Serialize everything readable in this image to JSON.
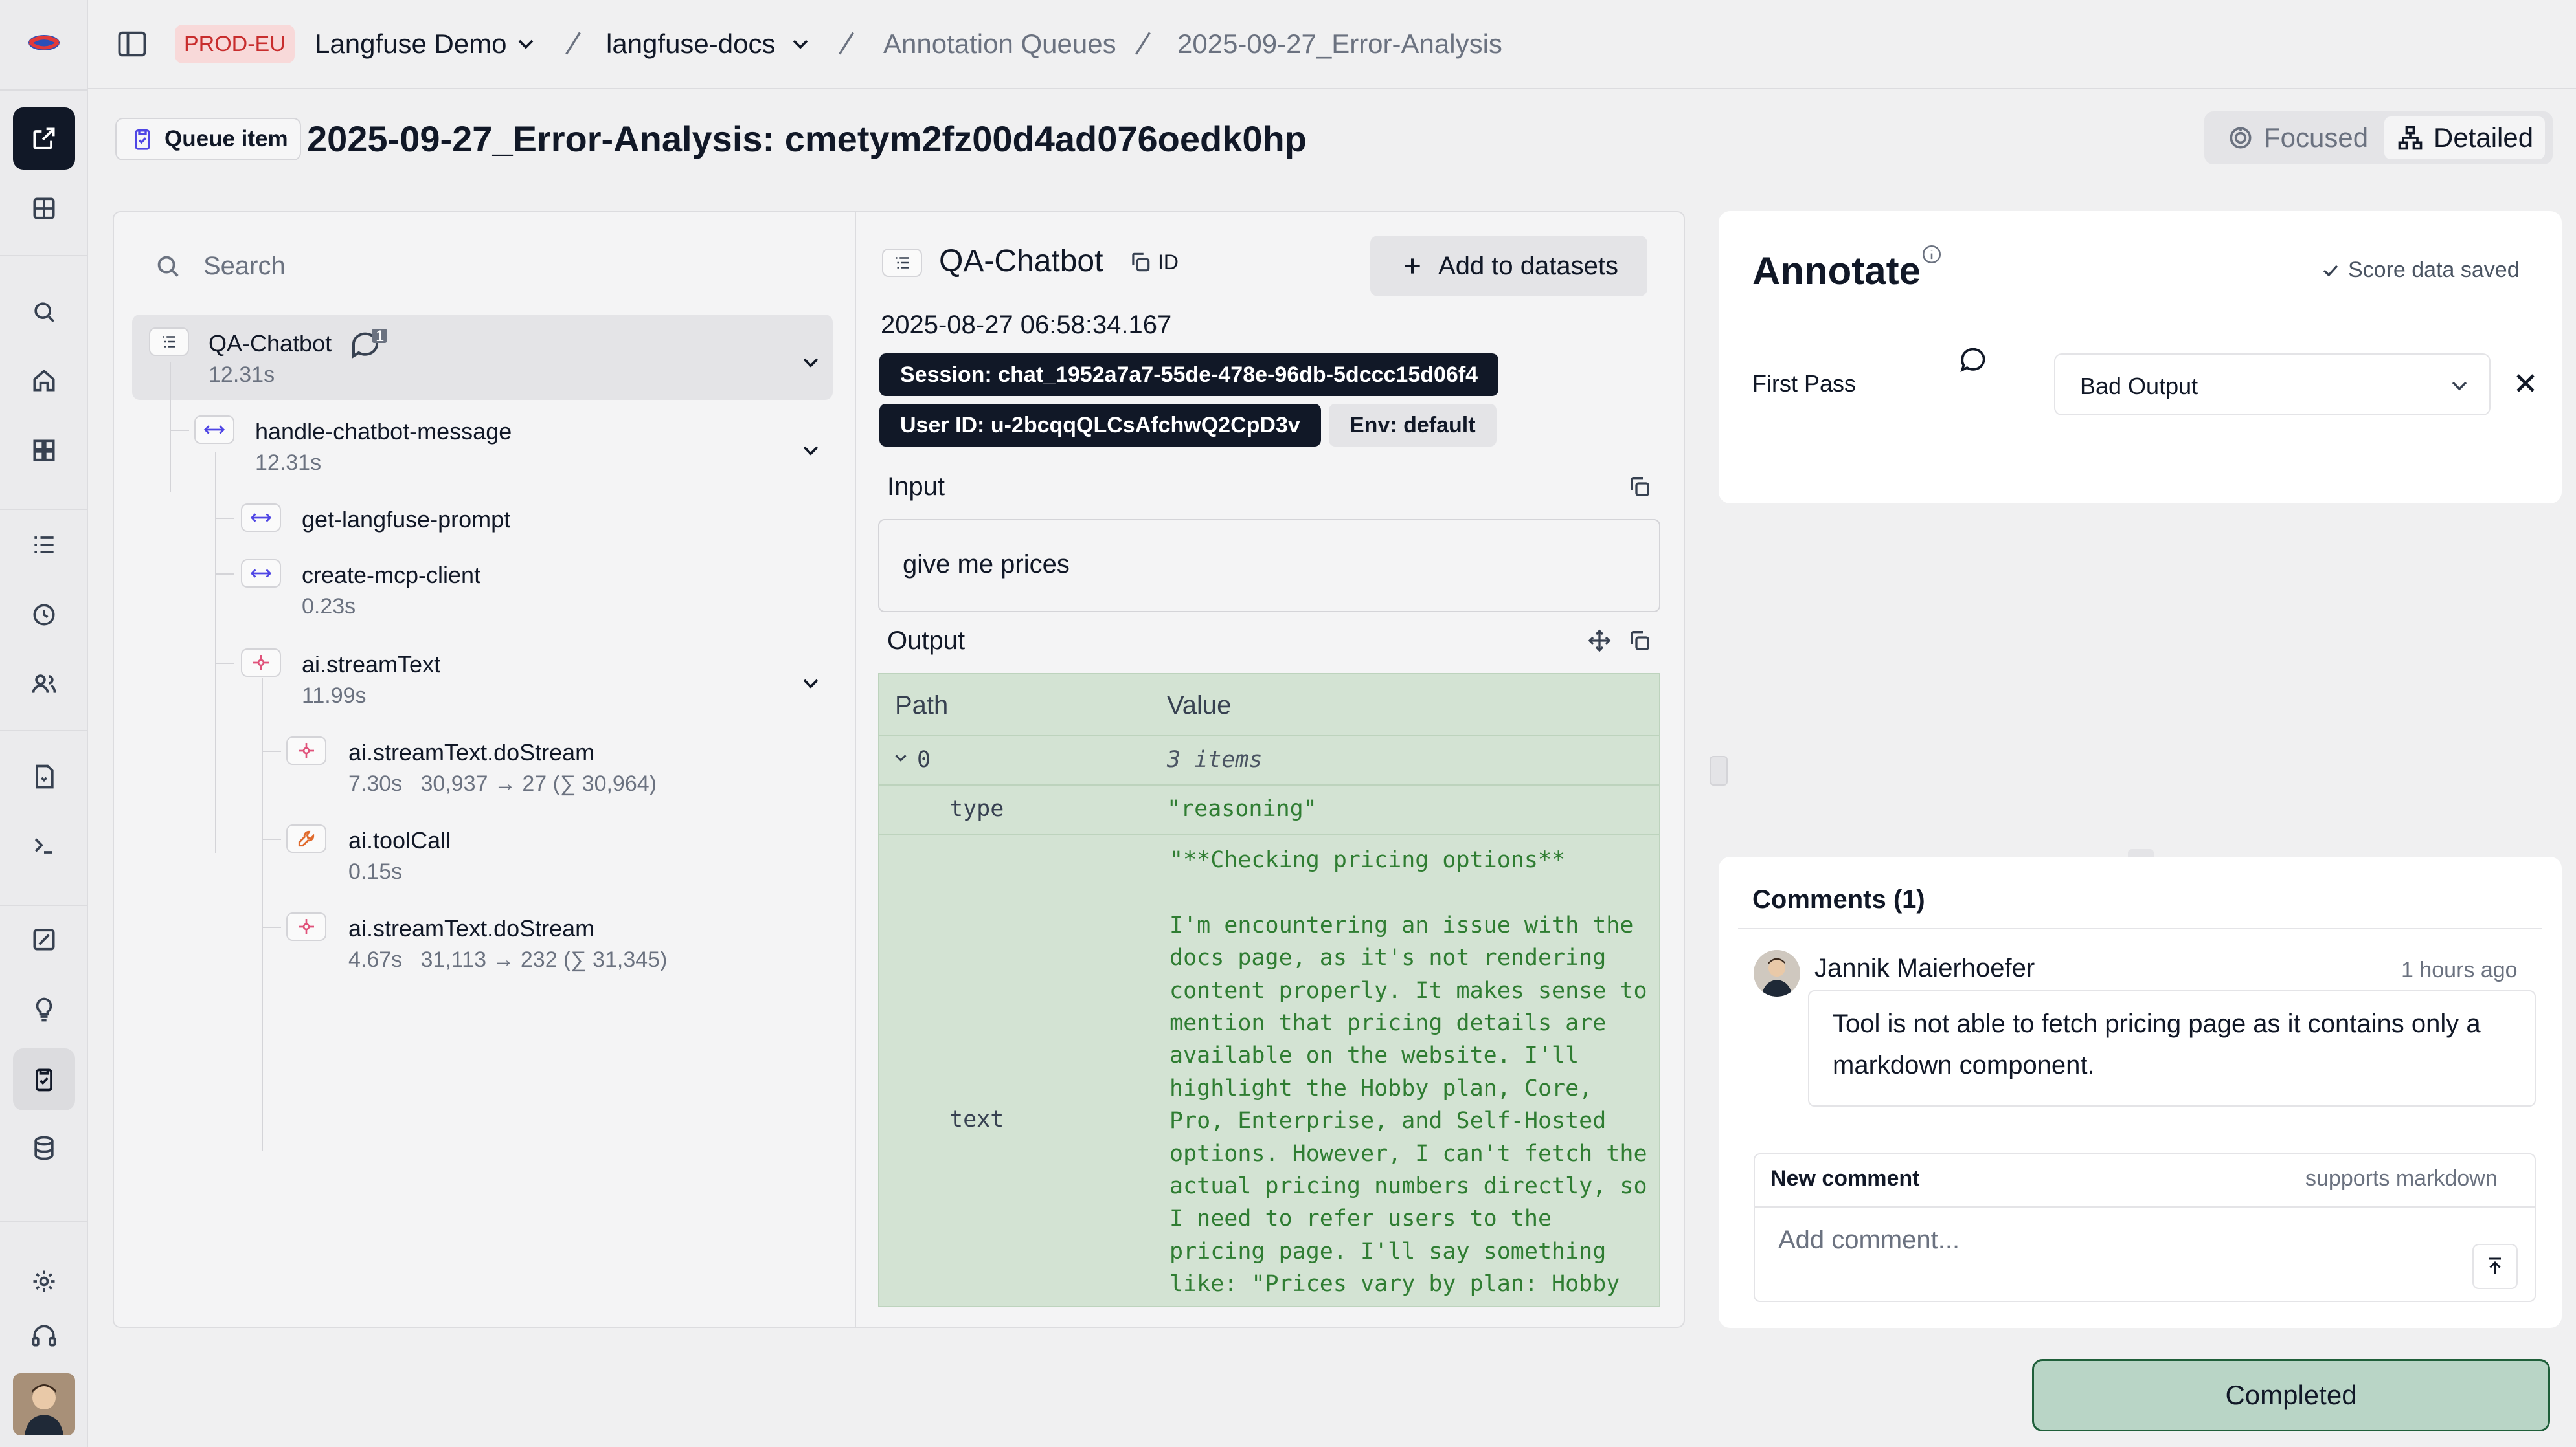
{
  "topbar": {
    "env": "PROD-EU",
    "org": "Langfuse Demo",
    "project": "langfuse-docs",
    "section": "Annotation Queues",
    "queue": "2025-09-27_Error-Analysis"
  },
  "header": {
    "badge": "Queue item",
    "title": "2025-09-27_Error-Analysis: cmetym2fz00d4ad076oedk0hp",
    "view_focused": "Focused",
    "view_detailed": "Detailed"
  },
  "tree": {
    "search_placeholder": "Search",
    "comment_count": "1",
    "nodes": [
      {
        "label": "QA-Chatbot",
        "meta": "12.31s"
      },
      {
        "label": "handle-chatbot-message",
        "meta": "12.31s"
      },
      {
        "label": "get-langfuse-prompt",
        "meta": ""
      },
      {
        "label": "create-mcp-client",
        "meta": "0.23s"
      },
      {
        "label": "ai.streamText",
        "meta": "11.99s"
      },
      {
        "label": "ai.streamText.doStream",
        "meta": "7.30s   30,937 → 27 (∑ 30,964)"
      },
      {
        "label": "ai.toolCall",
        "meta": "0.15s"
      },
      {
        "label": "ai.streamText.doStream",
        "meta": "4.67s   31,113 → 232 (∑ 31,345)"
      }
    ]
  },
  "detail": {
    "name": "QA-Chatbot",
    "id_label": "ID",
    "add_to_datasets": "Add to datasets",
    "timestamp": "2025-08-27 06:58:34.167",
    "session": "Session: chat_1952a7a7-55de-478e-96db-5dccc15d06f4",
    "user_id": "User ID: u-2bcqqQLCsAfchwQ2CpD3v",
    "env": "Env: default",
    "input_title": "Input",
    "input_value": "give me prices",
    "output_title": "Output",
    "output_table": {
      "col_path": "Path",
      "col_value": "Value",
      "root_key": "0",
      "root_value": "3 items",
      "type_key": "type",
      "type_value": "\"reasoning\"",
      "text_key": "text",
      "text_value": "\"**Checking pricing options**\n\nI'm encountering an issue with the docs page, as it's not rendering content properly. It makes sense to mention that pricing details are available on the website. I'll highlight the Hobby plan, Core, Pro, Enterprise, and Self-Hosted options. However, I can't fetch the actual pricing numbers directly, so I need to refer users to the pricing page. I'll say something like: \"Prices vary by plan: Hobby is free, while Pro and Enterprise are paid tiers.\""
    }
  },
  "annotate": {
    "title": "Annotate",
    "status": "Score data saved",
    "score_name": "First Pass",
    "score_value": "Bad Output"
  },
  "comments": {
    "title": "Comments (1)",
    "author": "Jannik Maierhoefer",
    "time": "1 hours ago",
    "body": "Tool is not able to fetch pricing page as it contains only a markdown component.",
    "new_label": "New comment",
    "markdown_hint": "supports markdown",
    "placeholder": "Add comment..."
  },
  "footer": {
    "completed": "Completed"
  },
  "colors": {
    "accent_dark": "#111827",
    "env_badge_bg": "#f8d9d9",
    "env_badge_text": "#c82d2d",
    "output_bg": "#d3e3d3",
    "output_text": "#2f7d32",
    "completed_border": "#1f5f3a"
  }
}
